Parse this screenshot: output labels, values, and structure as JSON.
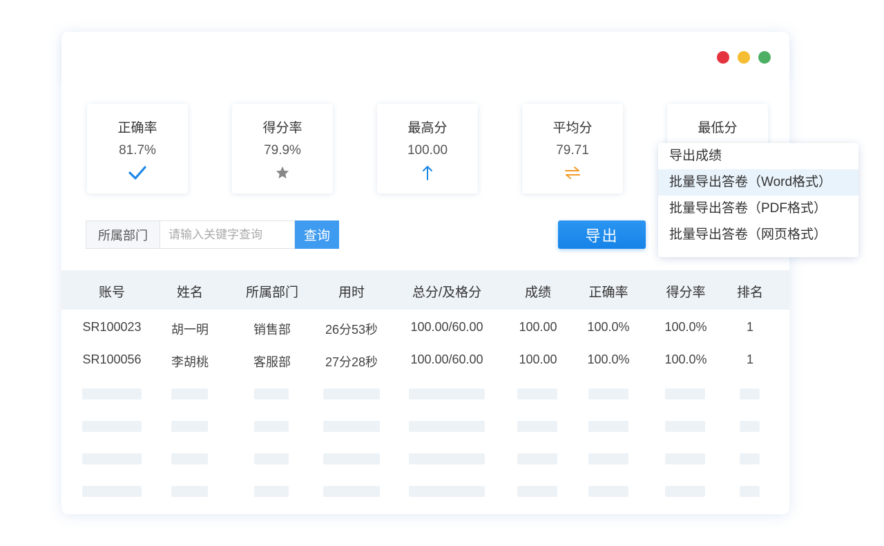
{
  "window": {
    "controls": [
      {
        "name": "close",
        "color": "#e5323f"
      },
      {
        "name": "minimize",
        "color": "#f4bd32"
      },
      {
        "name": "maximize",
        "color": "#4caf63"
      }
    ]
  },
  "stats": [
    {
      "label": "正确率",
      "value": "81.7%",
      "icon": "check-icon",
      "icon_color": "#1e88e5"
    },
    {
      "label": "得分率",
      "value": "79.9%",
      "icon": "star-icon",
      "icon_color": "#888888"
    },
    {
      "label": "最高分",
      "value": "100.00",
      "icon": "arrow-up-icon",
      "icon_color": "#1e88e5"
    },
    {
      "label": "平均分",
      "value": "79.71",
      "icon": "swap-icon",
      "icon_color": "#f39a28"
    },
    {
      "label": "最低分",
      "value": "",
      "icon": "",
      "icon_color": ""
    }
  ],
  "search": {
    "dept_label": "所属部门",
    "placeholder": "请输入关键字查询",
    "value": "",
    "query_label": "查询"
  },
  "export": {
    "label": "导出",
    "menu": [
      {
        "label": "导出成绩",
        "active": false
      },
      {
        "label": "批量导出答卷（Word格式）",
        "active": true
      },
      {
        "label": "批量导出答卷（PDF格式）",
        "active": false
      },
      {
        "label": "批量导出答卷（网页格式）",
        "active": false
      }
    ]
  },
  "table": {
    "columns": [
      "账号",
      "姓名",
      "所属部门",
      "用时",
      "总分/及格分",
      "成绩",
      "正确率",
      "得分率",
      "排名"
    ],
    "rows": [
      [
        "SR100023",
        "胡一明",
        "销售部",
        "26分53秒",
        "100.00/60.00",
        "100.00",
        "100.0%",
        "100.0%",
        "1"
      ],
      [
        "SR100056",
        "李胡桃",
        "客服部",
        "27分28秒",
        "100.00/60.00",
        "100.00",
        "100.0%",
        "100.0%",
        "1"
      ]
    ],
    "placeholder_rows": 4
  },
  "colors": {
    "accent": "#1683e8",
    "query_button": "#3f9bf0",
    "header_bg": "#eef3f7",
    "placeholder_bar": "#edf2f7"
  }
}
